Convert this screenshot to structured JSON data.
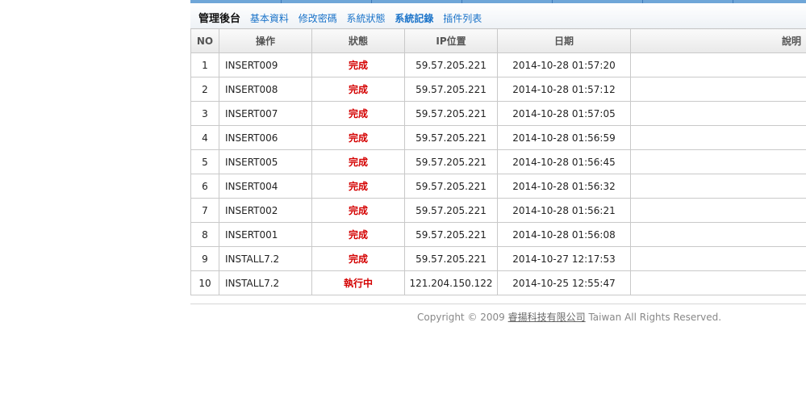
{
  "nav": {
    "title": "管理後台",
    "links": [
      "基本資料",
      "修改密碼",
      "系統狀態",
      "系統記錄",
      "插件列表"
    ],
    "active_index": 3
  },
  "table": {
    "headers": [
      "NO",
      "操作",
      "狀態",
      "IP位置",
      "日期",
      "說明"
    ],
    "rows": [
      {
        "no": "1",
        "op": "INSERT009",
        "status": "完成",
        "ip": "59.57.205.221",
        "date": "2014-10-28 01:57:20",
        "desc": ""
      },
      {
        "no": "2",
        "op": "INSERT008",
        "status": "完成",
        "ip": "59.57.205.221",
        "date": "2014-10-28 01:57:12",
        "desc": ""
      },
      {
        "no": "3",
        "op": "INSERT007",
        "status": "完成",
        "ip": "59.57.205.221",
        "date": "2014-10-28 01:57:05",
        "desc": ""
      },
      {
        "no": "4",
        "op": "INSERT006",
        "status": "完成",
        "ip": "59.57.205.221",
        "date": "2014-10-28 01:56:59",
        "desc": ""
      },
      {
        "no": "5",
        "op": "INSERT005",
        "status": "完成",
        "ip": "59.57.205.221",
        "date": "2014-10-28 01:56:45",
        "desc": ""
      },
      {
        "no": "6",
        "op": "INSERT004",
        "status": "完成",
        "ip": "59.57.205.221",
        "date": "2014-10-28 01:56:32",
        "desc": ""
      },
      {
        "no": "7",
        "op": "INSERT002",
        "status": "完成",
        "ip": "59.57.205.221",
        "date": "2014-10-28 01:56:21",
        "desc": ""
      },
      {
        "no": "8",
        "op": "INSERT001",
        "status": "完成",
        "ip": "59.57.205.221",
        "date": "2014-10-28 01:56:08",
        "desc": ""
      },
      {
        "no": "9",
        "op": "INSTALL7.2",
        "status": "完成",
        "ip": "59.57.205.221",
        "date": "2014-10-27 12:17:53",
        "desc": ""
      },
      {
        "no": "10",
        "op": "INSTALL7.2",
        "status": "執行中",
        "ip": "121.204.150.122",
        "date": "2014-10-25 12:55:47",
        "desc": ""
      }
    ]
  },
  "footer": {
    "prefix": "Copyright © 2009 ",
    "company": "睿揚科技有限公司",
    "suffix": " Taiwan All Rights Reserved."
  },
  "colors": {
    "accent": "#1a73c9",
    "status_text": "#d40000",
    "top_strip": "#6fa6d8"
  }
}
